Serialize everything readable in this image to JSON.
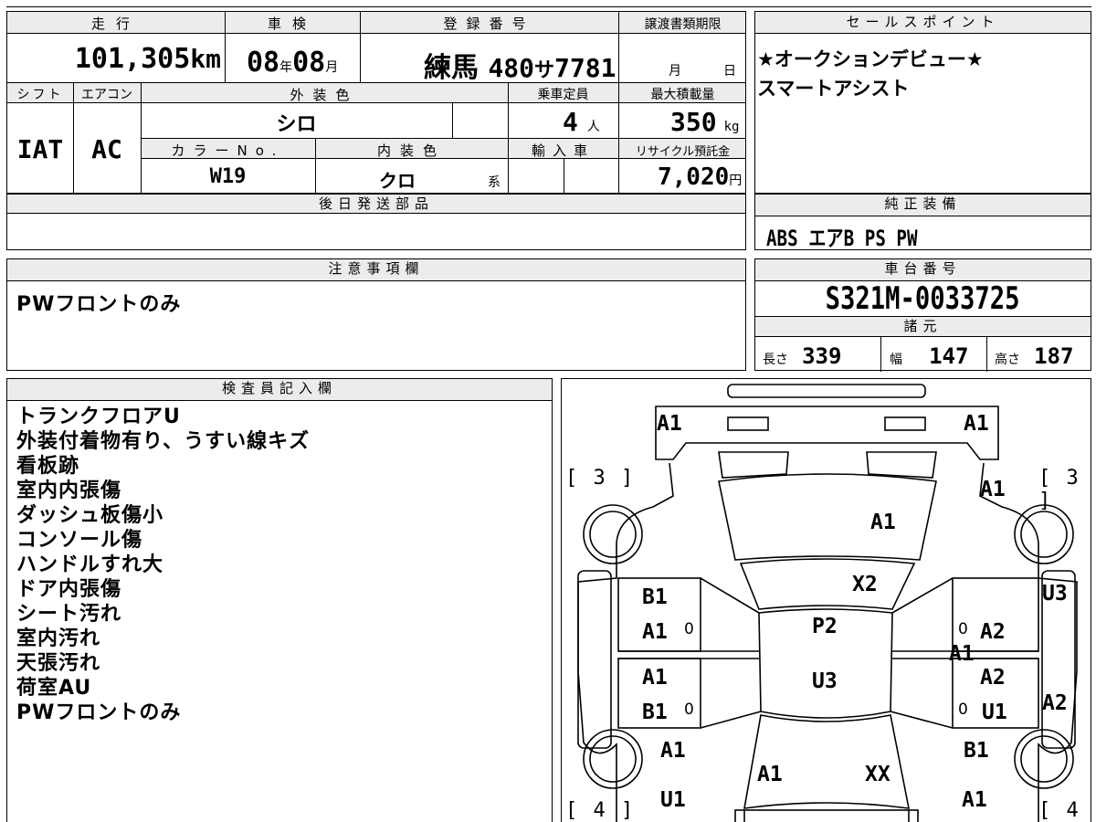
{
  "car_info": {
    "headers": {
      "mileage": "走行",
      "inspection": "車検",
      "registration": "登録番号",
      "transfer_deadline": "譲渡書類期限",
      "shift": "シフト",
      "aircon": "エアコン",
      "exterior_color": "外装色",
      "capacity": "乗車定員",
      "max_load": "最大積載量",
      "color_no": "カラーNo.",
      "interior_color": "内装色",
      "import": "輸入車",
      "recycle_fee": "リサイクル預託金"
    },
    "mileage_value": "101,305",
    "mileage_unit": "km",
    "inspection_year": "08",
    "inspection_year_unit": "年",
    "inspection_month": "08",
    "inspection_month_unit": "月",
    "reg_area": "練馬",
    "reg_number_1": "480",
    "reg_kana": "サ",
    "reg_number_2": "7781",
    "deadline_month_unit": "月",
    "deadline_day_unit": "日",
    "shift_value": "IAT",
    "aircon_value": "AC",
    "exterior_color_value": "シロ",
    "capacity_value": "4",
    "capacity_unit": "人",
    "max_load_value": "350",
    "max_load_unit": "kg",
    "color_no_value": "W19",
    "interior_color_value": "クロ",
    "interior_color_suffix": "系",
    "recycle_fee_value": "7,020",
    "recycle_fee_unit": "円"
  },
  "later_parts": {
    "header": "後日発送部品"
  },
  "sales_points": {
    "header": "セールスポイント",
    "lines": [
      "★オークションデビュー★",
      "スマートアシスト"
    ]
  },
  "equipment": {
    "header": "純正装備",
    "items": "ABS エアB PS PW"
  },
  "caution": {
    "header": "注意事項欄",
    "text": "PWフロントのみ"
  },
  "chassis": {
    "header": "車台番号",
    "number": "S321M-0033725"
  },
  "specs": {
    "header": "諸元",
    "length_label": "長さ",
    "length_value": "339",
    "width_label": "幅",
    "width_value": "147",
    "height_label": "高さ",
    "height_value": "187"
  },
  "inspector": {
    "header": "検査員記入欄",
    "notes": [
      "トランクフロアU",
      "外装付着物有り、うすい線キズ",
      "看板跡",
      "室内内張傷",
      "ダッシュ板傷小",
      "コンソール傷",
      "ハンドルすれ大",
      "ドア内張傷",
      "シート汚れ",
      "室内汚れ",
      "天張汚れ",
      "荷室AU",
      "PWフロントのみ"
    ]
  },
  "diagram": {
    "tire_front_left": "[ 3 ]",
    "tire_front_right": "[ 3 ]",
    "tire_rear_left": "[ 4 ]",
    "tire_rear_right": "[ 4 ]",
    "marks": {
      "front_bumper_left": "A1",
      "front_bumper_right": "A1",
      "front_fender_right": "A1",
      "hood": "A1",
      "windshield": "X2",
      "left_front_door_1": "B1",
      "left_front_door_2": "A1",
      "right_front_door": "A2",
      "right_center": "A1",
      "roof_front": "P2",
      "roof_rear": "U3",
      "left_rear_door_1": "A1",
      "left_rear_door_2": "B1",
      "right_rear_door_1": "A2",
      "right_rear_door_2": "U1",
      "right_side_front": "U3",
      "right_side_rear": "A2",
      "left_rear_fender": "A1",
      "rear_hatch_left": "A1",
      "rear_hatch_right": "XX",
      "right_rear_fender": "B1",
      "left_rear_bottom": "U1",
      "right_rear_bottom": "A1"
    },
    "small_zero": "0"
  }
}
